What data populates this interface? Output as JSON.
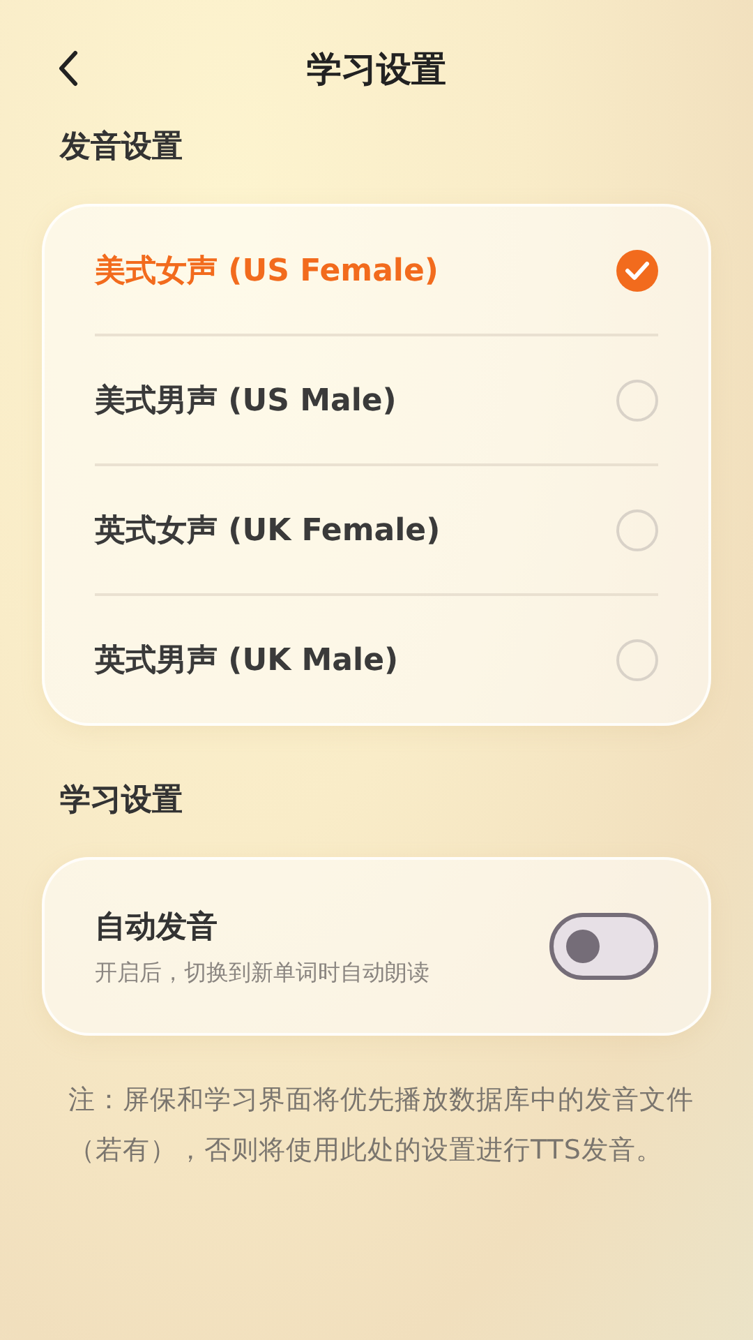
{
  "header": {
    "title": "学习设置"
  },
  "voice_section": {
    "title": "发音设置",
    "options": [
      {
        "label": "美式女声 (US Female)",
        "selected": true
      },
      {
        "label": "美式男声 (US Male)",
        "selected": false
      },
      {
        "label": "英式女声 (UK Female)",
        "selected": false
      },
      {
        "label": "英式男声 (UK Male)",
        "selected": false
      }
    ]
  },
  "study_section": {
    "title": "学习设置",
    "settings": [
      {
        "label": "自动发音",
        "description": "开启后，切换到新单词时自动朗读",
        "on": false
      }
    ]
  },
  "note": "注：屏保和学习界面将优先播放数据库中的发音文件（若有），否则将使用此处的设置进行TTS发音。"
}
